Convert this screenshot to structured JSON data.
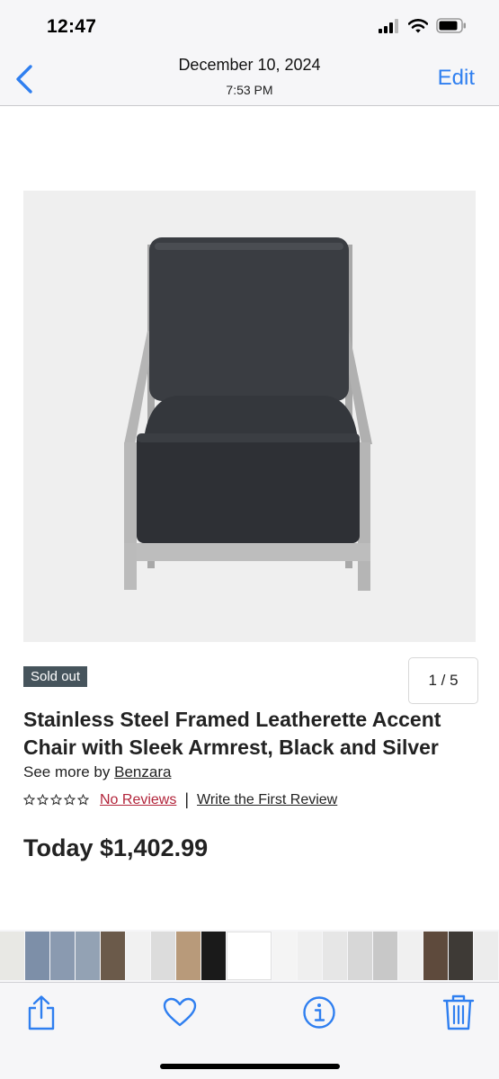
{
  "status_bar": {
    "time": "12:47"
  },
  "nav": {
    "title": "December 10, 2024",
    "subtitle": "7:53 PM",
    "edit_label": "Edit"
  },
  "product": {
    "image_counter": "1 / 5",
    "badge": "Sold out",
    "title": "Stainless Steel Framed Leatherette Accent Chair with Sleek Armrest, Black and Silver",
    "see_more_prefix": "See more by",
    "brand": "Benzara",
    "rating_stars": 0,
    "rating_max": 5,
    "no_reviews": "No Reviews",
    "write_review": "Write the First Review",
    "price": "Today $1,402.99"
  },
  "colors": {
    "accent": "#2f7ff0",
    "badge_bg": "#46545c",
    "review_link": "#b2243a"
  },
  "toolbar": {
    "icons": [
      "share-icon",
      "heart-icon",
      "info-icon",
      "trash-icon"
    ]
  }
}
